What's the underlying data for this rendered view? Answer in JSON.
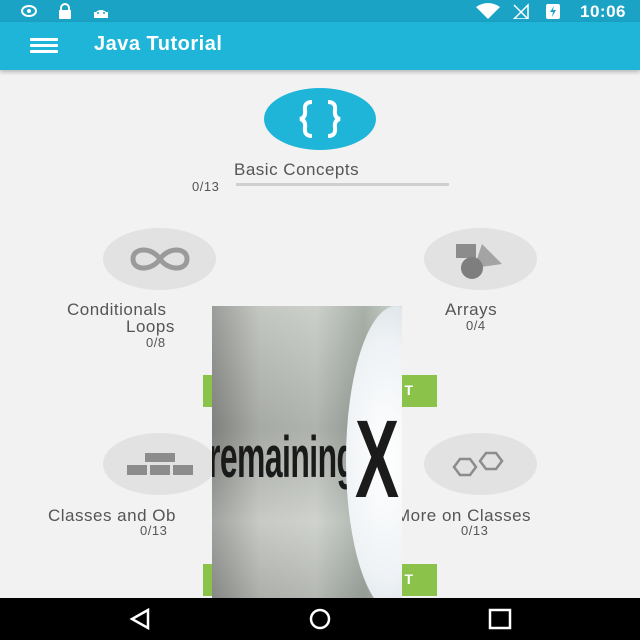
{
  "status_bar": {
    "time": "10:06"
  },
  "app_bar": {
    "title": "Java Tutorial"
  },
  "topics": [
    {
      "name": "Basic Concepts",
      "progress": "0/13"
    },
    {
      "name_line1": "Conditionals",
      "name_line2": "Loops",
      "progress": "0/8"
    },
    {
      "name": "Arrays",
      "progress": "0/4"
    },
    {
      "name": "Classes and Ob",
      "progress": "0/13"
    },
    {
      "name": "More on Classes",
      "progress": "0/13"
    }
  ],
  "buttons": {
    "start_label_1": "T",
    "start_label_2": "T"
  },
  "ad_overlay": {
    "text": "remaining",
    "close_glyph": "X"
  },
  "colors": {
    "accent": "#1fb5d8",
    "status": "#1ba3c6",
    "button": "#8bc34a"
  },
  "icons": {
    "basic": "braces-icon",
    "conditionals": "infinity-icon",
    "arrays": "shapes-icon",
    "classes": "bricks-icon",
    "more_classes": "hexagons-icon"
  }
}
